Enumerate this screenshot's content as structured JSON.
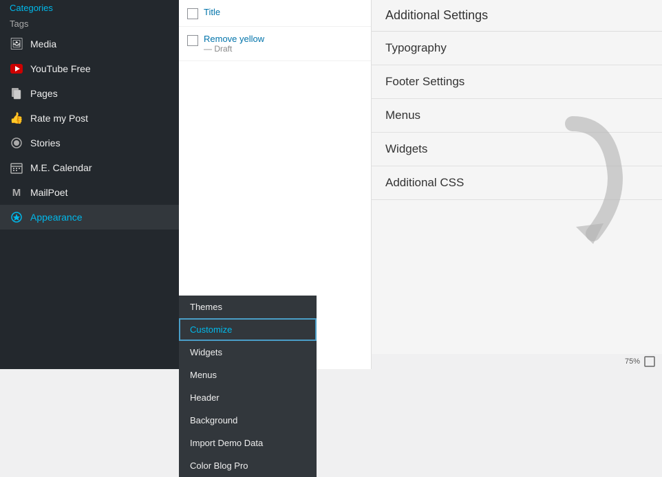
{
  "sidebar": {
    "items": [
      {
        "id": "media",
        "label": "Media",
        "icon": "🖼"
      },
      {
        "id": "youtube-free",
        "label": "YouTube Free",
        "icon": "▶"
      },
      {
        "id": "pages",
        "label": "Pages",
        "icon": "📄"
      },
      {
        "id": "rate-my-post",
        "label": "Rate my Post",
        "icon": "👍"
      },
      {
        "id": "stories",
        "label": "Stories",
        "icon": "⭕"
      },
      {
        "id": "me-calendar",
        "label": "M.E. Calendar",
        "icon": "📅"
      },
      {
        "id": "mailpoet",
        "label": "MailPoet",
        "icon": "M"
      },
      {
        "id": "appearance",
        "label": "Appearance",
        "icon": "🎨"
      }
    ],
    "sub_items": [
      {
        "id": "categories",
        "label": "Categories"
      },
      {
        "id": "tags",
        "label": "Tags"
      }
    ]
  },
  "appearance_dropdown": {
    "items": [
      {
        "id": "themes",
        "label": "Themes"
      },
      {
        "id": "customize",
        "label": "Customize",
        "highlighted": true
      },
      {
        "id": "widgets",
        "label": "Widgets"
      },
      {
        "id": "menus",
        "label": "Menus"
      },
      {
        "id": "header",
        "label": "Header"
      },
      {
        "id": "background",
        "label": "Background"
      },
      {
        "id": "import-demo",
        "label": "Import Demo Data"
      },
      {
        "id": "color-blog-pro",
        "label": "Color Blog Pro"
      }
    ]
  },
  "post_list": {
    "items": [
      {
        "id": "title-item",
        "label": "Title",
        "checked": false
      },
      {
        "id": "remove-yellow-item",
        "label": "Remove yellow",
        "sub": "— Draft",
        "checked": false,
        "link_color": "#0073aa"
      }
    ]
  },
  "customizer": {
    "heading": "Additional Settings",
    "sections": [
      {
        "id": "typography",
        "label": "Typography"
      },
      {
        "id": "footer-settings",
        "label": "Footer Settings"
      },
      {
        "id": "menus",
        "label": "Menus"
      },
      {
        "id": "widgets",
        "label": "Widgets"
      },
      {
        "id": "additional-css",
        "label": "Additional CSS"
      }
    ]
  },
  "bottom_bar": {
    "zoom": "75%"
  }
}
